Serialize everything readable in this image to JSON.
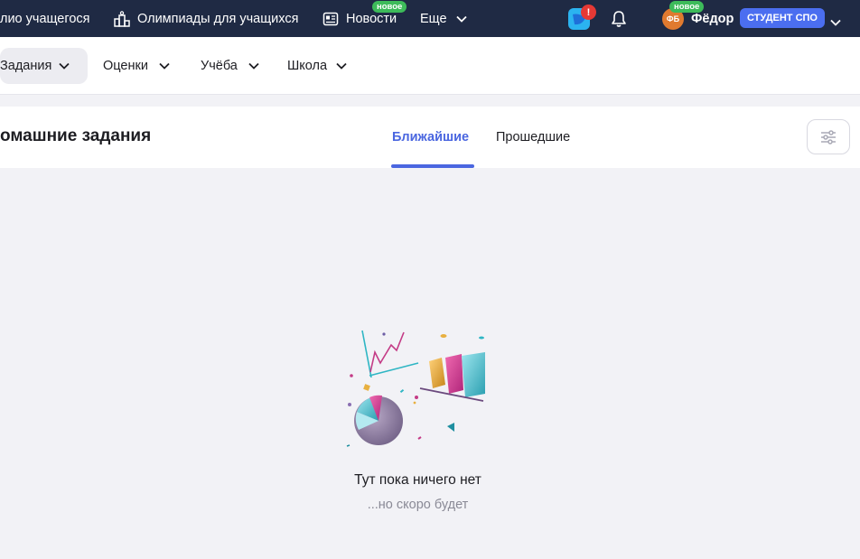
{
  "topbar": {
    "portfolio_label": "лио учащегося",
    "olympiads_label": "Олимпиады для учащихся",
    "news_label": "Новости",
    "news_badge": "новое",
    "more_label": "Еще",
    "notification_badge": "!",
    "user": {
      "initials": "ФБ",
      "name": "Фёдор",
      "badge": "новое",
      "role": "СТУДЕНТ СПО"
    }
  },
  "subnav": {
    "tabs": [
      {
        "label": "Задания"
      },
      {
        "label": "Оценки"
      },
      {
        "label": "Учёба"
      },
      {
        "label": "Школа"
      }
    ]
  },
  "header": {
    "title": "омашние задания",
    "segments": [
      {
        "label": "Ближайшие"
      },
      {
        "label": "Прошедшие"
      }
    ]
  },
  "empty_state": {
    "title": "Тут пока ничего нет",
    "subtitle": "...но скоро будет"
  },
  "colors": {
    "topbar_bg": "#1f2a44",
    "accent": "#4a66e0",
    "new_badge": "#3dbb5a",
    "page_bg": "#f2f2f6"
  }
}
